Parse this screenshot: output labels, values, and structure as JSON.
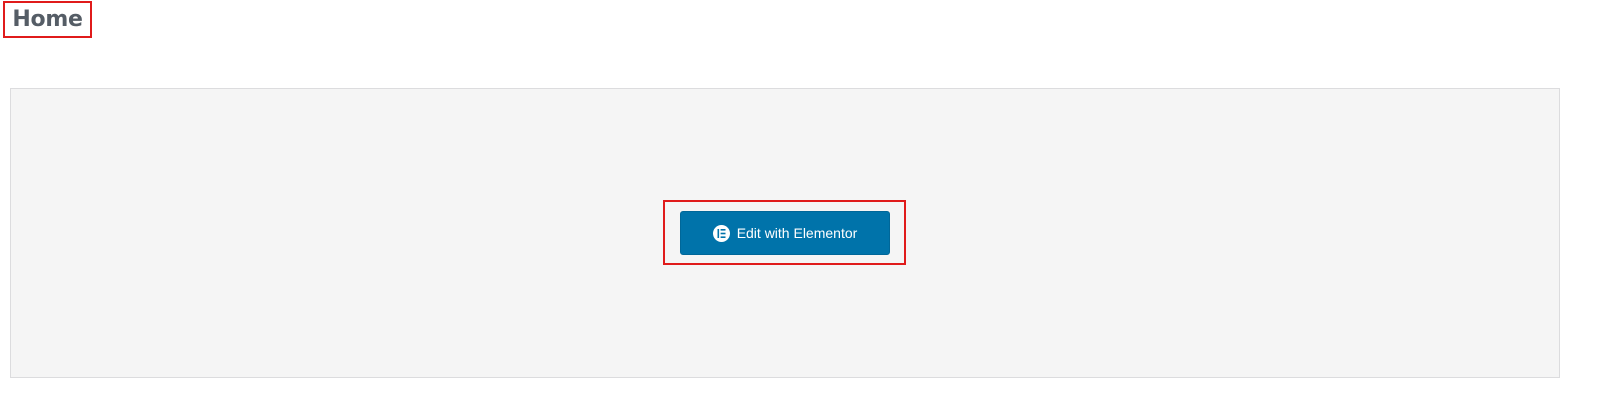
{
  "header": {
    "title": "Home"
  },
  "editor": {
    "button_label": "Edit with Elementor",
    "button_icon": "elementor-icon",
    "button_color": "#0073aa",
    "panel_color": "#f5f5f5"
  },
  "highlight_color": "#e01b1b"
}
